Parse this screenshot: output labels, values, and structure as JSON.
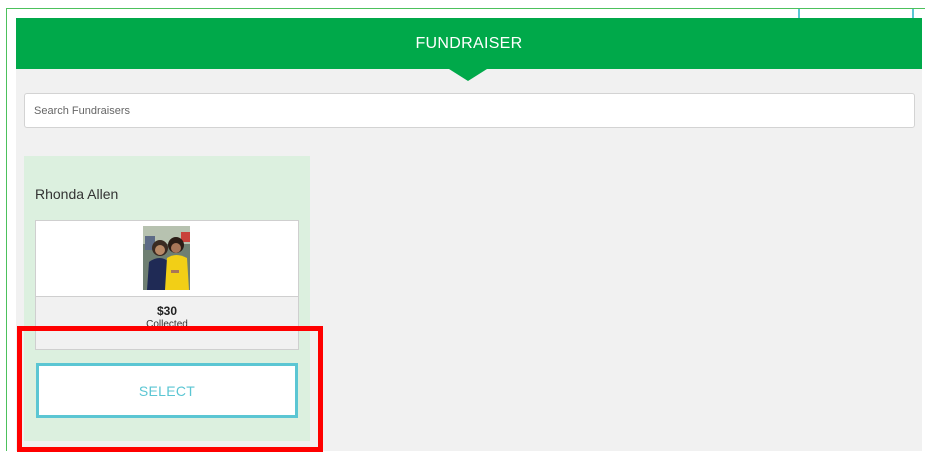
{
  "header": {
    "title": "FUNDRAISER"
  },
  "search": {
    "placeholder": "Search Fundraisers",
    "value": ""
  },
  "fundraisers": [
    {
      "name": "Rhonda Allen",
      "amount": "$30",
      "amount_label": "Collected",
      "select_label": "SELECT"
    }
  ],
  "colors": {
    "header_green": "#00a94a",
    "card_bg": "#dcf0df",
    "accent_teal": "#5bc6d3",
    "highlight_red": "#ff0000"
  },
  "icons": {
    "header_indicator": "caret-down-icon"
  }
}
